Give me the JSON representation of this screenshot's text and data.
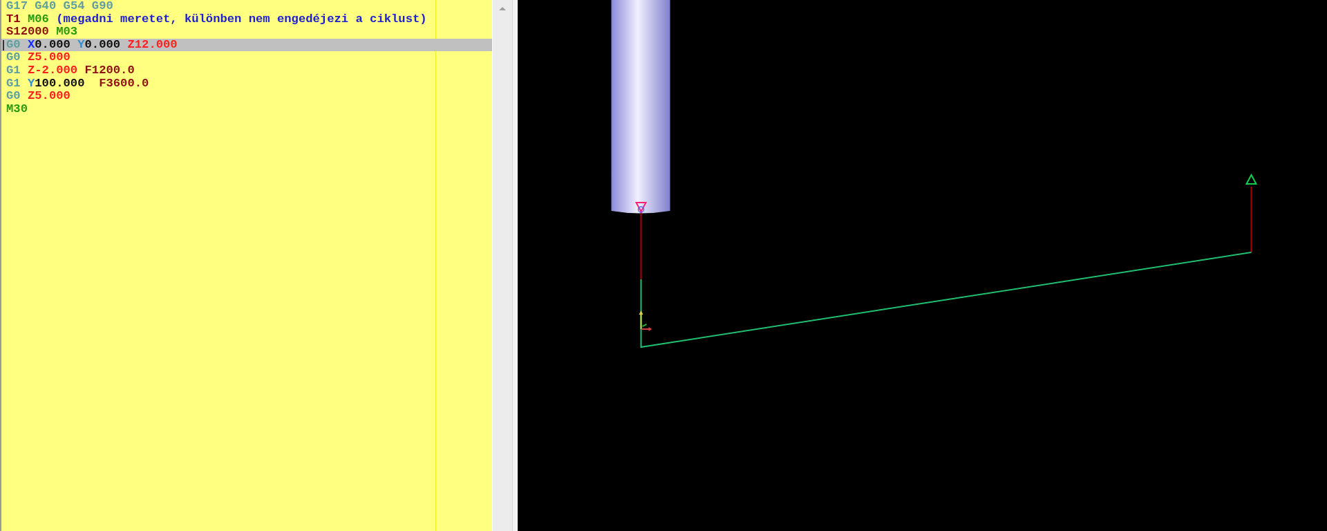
{
  "editor": {
    "lines": [
      {
        "selected": false,
        "words": [
          [
            {
              "text": "G17",
              "kind": "gcode"
            }
          ],
          [
            {
              "text": "G40",
              "kind": "gcode"
            }
          ],
          [
            {
              "text": "G54",
              "kind": "gcode"
            }
          ],
          [
            {
              "text": "G90",
              "kind": "gcode"
            }
          ]
        ]
      },
      {
        "selected": false,
        "words": [
          [
            {
              "text": "T1",
              "kind": "tool"
            }
          ],
          [
            {
              "text": "M06",
              "kind": "mcode"
            }
          ],
          [
            {
              "text": "(megadni meretet, különben nem engedéjezi a ciklust)",
              "kind": "comment"
            }
          ]
        ]
      },
      {
        "selected": false,
        "words": [
          [
            {
              "text": "S12000",
              "kind": "feed"
            }
          ],
          [
            {
              "text": "M03",
              "kind": "mcode"
            }
          ]
        ]
      },
      {
        "selected": true,
        "words": [
          [
            {
              "text": "G0",
              "kind": "gcode"
            }
          ],
          [
            {
              "text": "X",
              "kind": "x"
            },
            {
              "text": "0.000",
              "kind": "number"
            }
          ],
          [
            {
              "text": "Y",
              "kind": "y"
            },
            {
              "text": "0.000",
              "kind": "number"
            }
          ],
          [
            {
              "text": "Z12.000",
              "kind": "z"
            }
          ]
        ]
      },
      {
        "selected": false,
        "words": [
          [
            {
              "text": "G0",
              "kind": "gcode"
            }
          ],
          [
            {
              "text": "Z5.000",
              "kind": "z"
            }
          ]
        ]
      },
      {
        "selected": false,
        "words": [
          [
            {
              "text": "G1",
              "kind": "gcode"
            }
          ],
          [
            {
              "text": "Z-2.000",
              "kind": "z"
            }
          ],
          [
            {
              "text": "F1200.0",
              "kind": "feed"
            }
          ]
        ]
      },
      {
        "selected": false,
        "words": [
          [
            {
              "text": "G1",
              "kind": "gcode"
            }
          ],
          [
            {
              "text": "Y",
              "kind": "y"
            },
            {
              "text": "100.000 ",
              "kind": "number"
            }
          ],
          [
            {
              "text": "F3600.0",
              "kind": "feed"
            }
          ]
        ]
      },
      {
        "selected": false,
        "words": [
          [
            {
              "text": "G0",
              "kind": "gcode"
            }
          ],
          [
            {
              "text": "Z5.000",
              "kind": "z"
            }
          ]
        ]
      },
      {
        "selected": false,
        "words": [
          [
            {
              "text": "M30",
              "kind": "mcode"
            }
          ]
        ]
      }
    ]
  }
}
